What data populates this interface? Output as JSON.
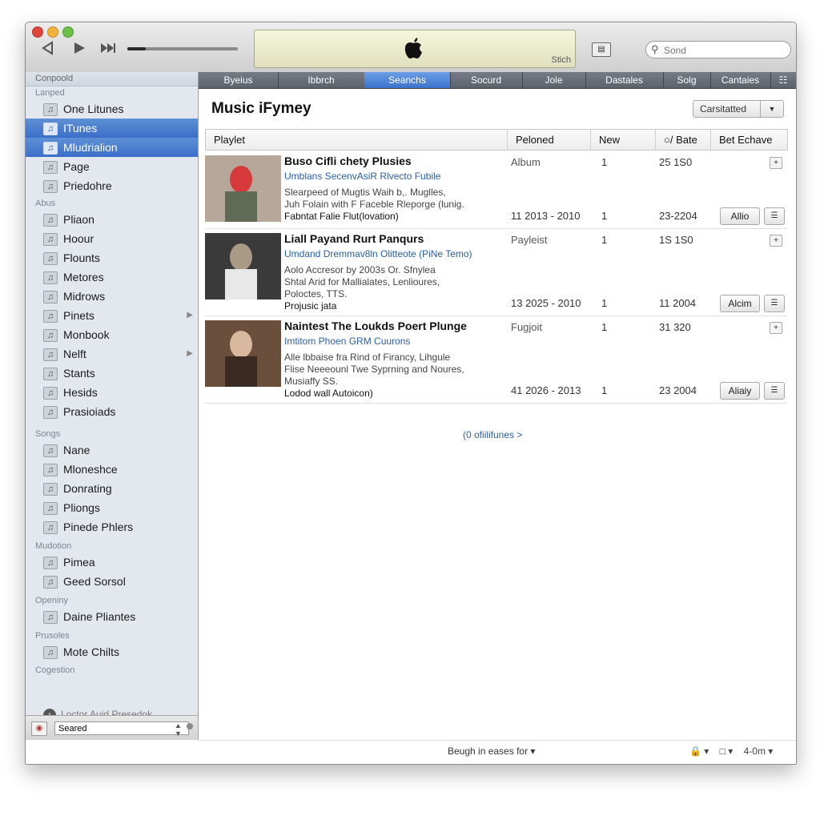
{
  "toolbar": {
    "lcd_text": "Stich",
    "search_placeholder": "Sond",
    "progress_fraction": 0.17,
    "view_icon": "list-view-icon"
  },
  "sidebar": {
    "top_header": "Conpoold",
    "sections": [
      {
        "title": "Lanped",
        "items": [
          {
            "label": "One Litunes",
            "icon": "music-icon"
          },
          {
            "label": "ITunes",
            "icon": "itunes-icon",
            "selected": true
          },
          {
            "label": "Mludrialion",
            "icon": "library-icon",
            "selected": true
          },
          {
            "label": "Page",
            "icon": "page-icon"
          },
          {
            "label": "Priedohre",
            "icon": "grid-icon"
          }
        ]
      },
      {
        "title": "Abus",
        "items": [
          {
            "label": "Pliаon",
            "icon": "speaker-icon"
          },
          {
            "label": "Hoour",
            "icon": "clip-icon"
          },
          {
            "label": "Flounts",
            "icon": "book-icon"
          },
          {
            "label": "Metores",
            "icon": "folder-icon"
          },
          {
            "label": "Midrows",
            "icon": "list-icon"
          },
          {
            "label": "Pinets",
            "icon": "playlist-icon",
            "arrow": true
          },
          {
            "label": "Monbook",
            "icon": "monitor-icon"
          },
          {
            "label": "Nelft",
            "icon": "genius-icon",
            "arrow": true
          },
          {
            "label": "Stants",
            "icon": "radio-icon"
          },
          {
            "label": "Hesids",
            "icon": "note-icon"
          },
          {
            "label": "Prasioiads",
            "icon": "download-icon"
          }
        ]
      },
      {
        "title": "Songs",
        "items": [
          {
            "label": "Nane",
            "icon": "list-icon"
          },
          {
            "label": "Mloneshce",
            "icon": "ping-icon"
          },
          {
            "label": "Donrating",
            "icon": "person-icon"
          },
          {
            "label": "Pliongs",
            "icon": "phone-icon"
          },
          {
            "label": "Pinede Phlers",
            "icon": "grid-icon"
          }
        ]
      },
      {
        "title": "Mudotion",
        "items": [
          {
            "label": "Pimea",
            "icon": "drive-icon"
          },
          {
            "label": "Geed Sorsol",
            "icon": "person-icon"
          }
        ]
      },
      {
        "title": "Openiny",
        "items": [
          {
            "label": "Daine Pliantes",
            "icon": "smart-folder-icon"
          }
        ]
      },
      {
        "title": "Prusoles",
        "items": [
          {
            "label": "Mote Chilts",
            "icon": "home-icon"
          }
        ]
      },
      {
        "title": "Cogestion",
        "items": []
      }
    ],
    "add_label": "Loctor Auid Presedok",
    "bottom_input": "Seared"
  },
  "tabs": [
    {
      "label": "Byeius"
    },
    {
      "label": "Ibbrch"
    },
    {
      "label": "Seanchs",
      "selected": true
    },
    {
      "label": "Socurd"
    },
    {
      "label": "Jole"
    },
    {
      "label": "Dastales"
    },
    {
      "label": "Solg"
    },
    {
      "label": "Cantaies"
    }
  ],
  "tabs_extra": "☷",
  "main": {
    "title": "Music iFymey",
    "sort_label": "Carsitatted",
    "columns": [
      "Playlet",
      "Peloned",
      "New",
      "○/ Bate",
      "Bet Echave"
    ],
    "rows": [
      {
        "title": "Buso Cifli chety Plusies",
        "subtitle": "Umblans SecenvAsiR Rlvecto Fubile",
        "desc": [
          "Slearpeed of Mugtis Waih b,. Muglles,",
          "Juh Folain with F Faceble Rleporge (lunig."
        ],
        "last": "Fabntat Falie Flut(lovation)",
        "type": "Album",
        "new": "1",
        "rate": "25 1S0",
        "range": "11 2013 - 2010",
        "new2": "1",
        "date": "23-2204",
        "button": "Allio"
      },
      {
        "title": "Liall Payand Rurt Panqurs",
        "subtitle": "Umdand Dremmav8ln Olitteote (PiNe Temo)",
        "desc": [
          "Aolo Accresor by 2003s Or. Sfnylea",
          "Shtal Arid for Mallialates, Lenlioures,",
          "Poloctes, TTS."
        ],
        "last": "Projusic jata",
        "type": "Payleist",
        "new": "1",
        "rate": "1S 1S0",
        "range": "13 2025 - 2010",
        "new2": "1",
        "date": "11 2004",
        "button": "Alcim"
      },
      {
        "title": "Naintest The Loukds Poert Plunge",
        "subtitle": "Imtitom Phoen GRM Cuurons",
        "desc": [
          "Alle lbbaise fra Rind of Firancy, Lihgule",
          "Flise Neeeounl Twe Syprning and Noures,",
          "Musiaffy SS."
        ],
        "last": "Lodod wall Autoicon)",
        "type": "Fugjoit",
        "new": "1",
        "rate": "31 320",
        "range": "41 2026 - 2013",
        "new2": "1",
        "date": "23 2004",
        "button": "Aliaiy"
      }
    ],
    "more_link": "(0 ofiilifunes >",
    "status_text": "Beugh in eases for ▾",
    "status_right": [
      "🔒 ▾",
      "□ ▾",
      "4-0m ▾"
    ]
  }
}
